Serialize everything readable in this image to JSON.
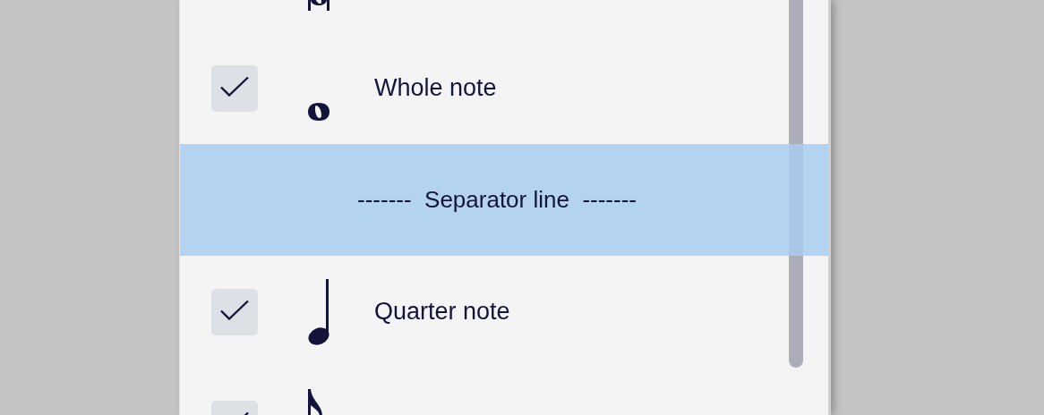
{
  "items": [
    {
      "kind": "breve"
    },
    {
      "kind": "whole",
      "checked": true,
      "label": "Whole note",
      "selected": false
    },
    {
      "kind": "separator",
      "label": "-------  Separator line  -------",
      "selected": true
    },
    {
      "kind": "quarter",
      "checked": true,
      "label": "Quarter note",
      "selected": false
    },
    {
      "kind": "eighth",
      "checked": true
    }
  ]
}
